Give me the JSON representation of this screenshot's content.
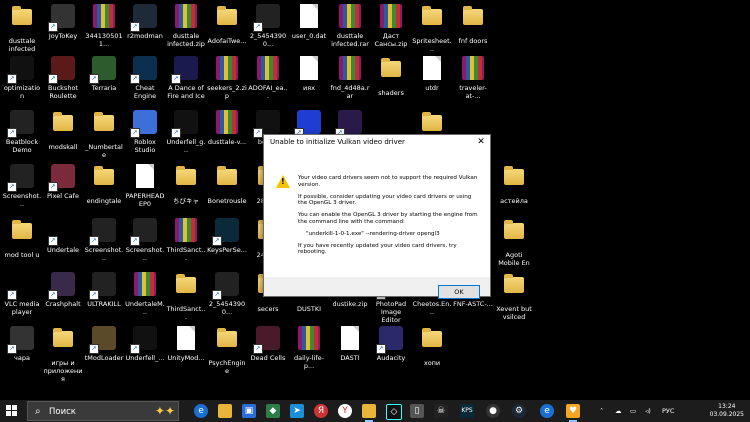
{
  "desktop_icons": [
    {
      "label": "dusttale infected",
      "kind": "folder"
    },
    {
      "label": "JoyToKey",
      "kind": "app",
      "color": "#333",
      "icon": "joystick-icon"
    },
    {
      "label": "3441305011...",
      "kind": "rar"
    },
    {
      "label": "r2modman",
      "kind": "app",
      "color": "#1e2a38",
      "icon": "r-icon"
    },
    {
      "label": "dusttale infected.zip",
      "kind": "rar"
    },
    {
      "label": "AdofaiTwe...",
      "kind": "folder"
    },
    {
      "label": "2_54543900...",
      "kind": "app",
      "color": "#222",
      "icon": "video-icon"
    },
    {
      "label": "user_0.dat",
      "kind": "doc"
    },
    {
      "label": "dusttale infected.rar",
      "kind": "rar"
    },
    {
      "label": "Даст Сансы.zip",
      "kind": "rar"
    },
    {
      "label": "Spritesheet...",
      "kind": "folder"
    },
    {
      "label": "fnf doors",
      "kind": "folder"
    },
    {
      "label": "optimization",
      "kind": "app",
      "color": "#111",
      "icon": "shortcut-icon"
    },
    {
      "label": "Buckshot Roulette",
      "kind": "app",
      "color": "#5a1a1a",
      "icon": "skull-icon"
    },
    {
      "label": "Terraria",
      "kind": "app",
      "color": "#2d5b2d",
      "icon": "tree-icon"
    },
    {
      "label": "Cheat Engine",
      "kind": "app",
      "color": "#0c2f4f",
      "icon": "gear-icon"
    },
    {
      "label": "A Dance of Fire and Ice",
      "kind": "app",
      "color": "#1a1a4f",
      "icon": "fireice-icon"
    },
    {
      "label": "seekers_2.zip",
      "kind": "rar"
    },
    {
      "label": "ADOFAI_ea...",
      "kind": "rar"
    },
    {
      "label": "иях",
      "kind": "doc"
    },
    {
      "label": "fnd_4d48a.rar",
      "kind": "rar"
    },
    {
      "label": "shaders",
      "kind": "folder"
    },
    {
      "label": "utdr",
      "kind": "doc"
    },
    {
      "label": "traveler-at-...",
      "kind": "rar"
    },
    {
      "label": "Beatblock Demo",
      "kind": "app",
      "color": "#222",
      "icon": "clock-icon"
    },
    {
      "label": "modskall",
      "kind": "folder"
    },
    {
      "label": "_Numbertale",
      "kind": "folder"
    },
    {
      "label": "Roblox Studio",
      "kind": "app",
      "color": "#3c6fd8",
      "icon": "roblox-icon"
    },
    {
      "label": "Underfell_g...",
      "kind": "app",
      "color": "#111",
      "icon": "underfell-icon"
    },
    {
      "label": "dusttale-v...",
      "kind": "rar"
    },
    {
      "label": "boar...",
      "kind": "app",
      "color": "#111",
      "icon": "underfell-icon"
    },
    {
      "label": "",
      "kind": "app",
      "color": "#1f3dd1",
      "icon": "bat-icon"
    },
    {
      "label": "",
      "kind": "app",
      "color": "#2a1a4a",
      "icon": "character-icon"
    },
    {
      "label": "",
      "kind": "folder"
    },
    {
      "label": "Screenshot...",
      "kind": "app",
      "color": "#222",
      "icon": "image-icon"
    },
    {
      "label": "Pixel Cafe",
      "kind": "app",
      "color": "#7a2a3a",
      "icon": "girl-icon"
    },
    {
      "label": "endingtale",
      "kind": "folder"
    },
    {
      "label": "PAPERHEAD EP0",
      "kind": "doc"
    },
    {
      "label": "ちびキャ",
      "kind": "folder"
    },
    {
      "label": "Bonetrousle",
      "kind": "folder"
    },
    {
      "label": "2811...",
      "kind": "folder"
    },
    {
      "label": "астейла",
      "kind": "folder"
    },
    {
      "label": "mod tool u",
      "kind": "folder"
    },
    {
      "label": "Undertale",
      "kind": "app",
      "color": "#000",
      "icon": "heart-icon"
    },
    {
      "label": "Screenshot...",
      "kind": "app",
      "color": "#222",
      "icon": "image-icon"
    },
    {
      "label": "Screenshot...",
      "kind": "app",
      "color": "#222",
      "icon": "image-icon"
    },
    {
      "label": "ThirdSanct...",
      "kind": "rar"
    },
    {
      "label": "KeysPerSe...",
      "kind": "app",
      "color": "#0a2a3a",
      "icon": "kps-icon"
    },
    {
      "label": "2485...",
      "kind": "folder"
    },
    {
      "label": "Agoti Mobile En",
      "kind": "folder"
    },
    {
      "label": "VLC media player",
      "kind": "app",
      "color": "#000",
      "icon": "vlc-icon"
    },
    {
      "label": "Crashphalt",
      "kind": "app",
      "color": "#3a2a4a",
      "icon": "ghost-icon"
    },
    {
      "label": "ULTRAKILL",
      "kind": "app",
      "color": "#222",
      "icon": "gun-icon"
    },
    {
      "label": "UndertaleM...",
      "kind": "rar"
    },
    {
      "label": "ThirdSanct...",
      "kind": "folder"
    },
    {
      "label": "2_54543900...",
      "kind": "app",
      "color": "#222",
      "icon": "video-icon"
    },
    {
      "label": "secers",
      "kind": "folder"
    },
    {
      "label": "DUSTKI",
      "kind": "folder"
    },
    {
      "label": "dustike.zip",
      "kind": "rar"
    },
    {
      "label": "PhotoPad Image Editor",
      "kind": "app",
      "color": "#2a4a7a",
      "icon": "photo-icon"
    },
    {
      "label": "Cheetos.En...",
      "kind": "rar"
    },
    {
      "label": "FNF-ASTC-...",
      "kind": "rar"
    },
    {
      "label": "Xevent but vsilced",
      "kind": "folder"
    },
    {
      "label": "чара",
      "kind": "app",
      "color": "#333",
      "icon": "image-icon"
    },
    {
      "label": "игры и приложения",
      "kind": "folder"
    },
    {
      "label": "tModLoader",
      "kind": "app",
      "color": "#5a4a2a",
      "icon": "tree-icon"
    },
    {
      "label": "Underfell_...",
      "kind": "app",
      "color": "#111",
      "icon": "underfell-icon"
    },
    {
      "label": "UnityMod...",
      "kind": "doc"
    },
    {
      "label": "PsychEngine",
      "kind": "folder"
    },
    {
      "label": "Dead Cells",
      "kind": "app",
      "color": "#4a1a2a",
      "icon": "dead-cells-icon"
    },
    {
      "label": "daily-life-p...",
      "kind": "rar"
    },
    {
      "label": "DASTI",
      "kind": "doc"
    },
    {
      "label": "Audacity",
      "kind": "app",
      "color": "#2a2a6a",
      "icon": "audacity-icon"
    },
    {
      "label": "хопи",
      "kind": "folder"
    }
  ],
  "dialog": {
    "title": "Unable to initialize Vulkan video driver",
    "close": "✕",
    "warning_icon": "!",
    "p1": "Your video card drivers seem not to support the required Vulkan version.",
    "p2": "If possible, consider updating your video card drivers or using the OpenGL 3 driver.",
    "p3": "You can enable the OpenGL 3 driver by starting the engine from the command line with the command:",
    "p4": "\"underkill-1-0-1.exe\" --rendering-driver opengl3",
    "p5": "If you have recently updated your video card drivers, try rebooting.",
    "ok": "OK"
  },
  "taskbar": {
    "search_placeholder": "Поиск",
    "language": "РУС",
    "time": "13:24",
    "date": "03.09.2025"
  }
}
